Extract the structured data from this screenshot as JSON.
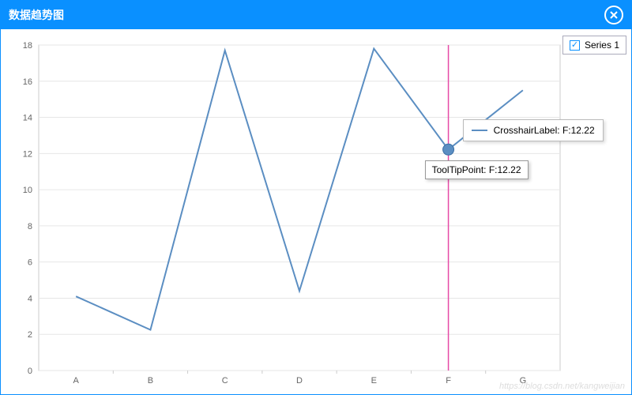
{
  "window": {
    "title": "数据趋势图"
  },
  "legend": {
    "series1_label": "Series 1",
    "checked": true
  },
  "crosshair": {
    "label_text": "CrosshairLabel: F:12.22"
  },
  "tooltip": {
    "text": "ToolTipPoint: F:12.22"
  },
  "watermark": "https://blog.csdn.net/kangweijian",
  "chart_data": {
    "type": "line",
    "title": "",
    "xlabel": "",
    "ylabel": "",
    "categories": [
      "A",
      "B",
      "C",
      "D",
      "E",
      "F",
      "G"
    ],
    "series": [
      {
        "name": "Series 1",
        "values": [
          4.1,
          2.25,
          17.7,
          4.4,
          17.8,
          12.22,
          15.5
        ]
      }
    ],
    "ylim": [
      0,
      18
    ],
    "yticks": [
      0,
      2,
      4,
      6,
      8,
      10,
      12,
      14,
      16,
      18
    ],
    "highlight_index": 5,
    "highlight_value": 12.22
  }
}
